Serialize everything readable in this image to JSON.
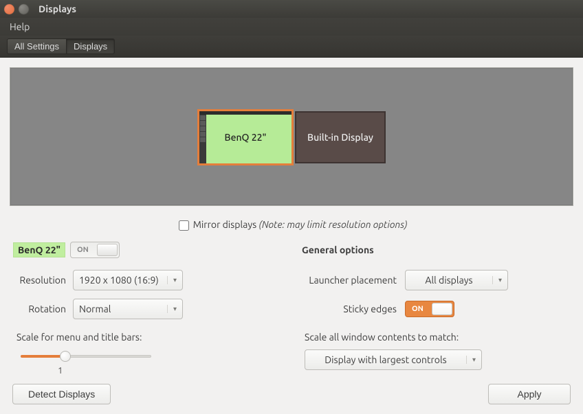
{
  "window": {
    "title": "Displays"
  },
  "menu": {
    "help": "Help"
  },
  "breadcrumb": {
    "all_settings": "All Settings",
    "displays": "Displays"
  },
  "arrangement": {
    "monitor1_label": "BenQ 22\"",
    "monitor2_label": "Built-in Display"
  },
  "mirror": {
    "label": "Mirror displays",
    "note": "(Note: may limit resolution options)"
  },
  "selected_display": {
    "name": "BenQ 22\"",
    "power_label": "ON",
    "resolution_label": "Resolution",
    "resolution_value": "1920 x 1080 (16:9)",
    "rotation_label": "Rotation",
    "rotation_value": "Normal",
    "scale_label": "Scale for menu and title bars:",
    "scale_value": "1"
  },
  "general": {
    "heading": "General options",
    "launcher_label": "Launcher placement",
    "launcher_value": "All displays",
    "sticky_label": "Sticky edges",
    "sticky_value": "ON",
    "scale_all_label": "Scale all window contents to match:",
    "scale_all_value": "Display with largest controls"
  },
  "buttons": {
    "detect": "Detect Displays",
    "apply": "Apply"
  }
}
